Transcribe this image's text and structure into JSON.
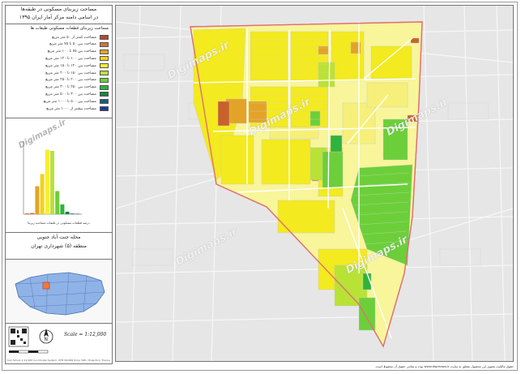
{
  "title": {
    "line1": "مساحت زیربنای مسکونی در طبقه‌ها",
    "line2": "در اسامی دامنه مرکز آمار ایران ۱۳۹۵"
  },
  "legend": {
    "title": "مساحت زیربنای قطعات مسکونی طبقات ها",
    "items": [
      {
        "label": "مساحت کمتر از ۵۰ متر مربع",
        "color": "#b5472c"
      },
      {
        "label": "مساحت بین ۵۰ تا ۷۵ متر مربع",
        "color": "#d2752e"
      },
      {
        "label": "مساحت بین ۷۵ تا ۱۰۰ متر مربع",
        "color": "#e3a329"
      },
      {
        "label": "مساحت بین ۱۰۰ تا ۱۲۰ متر مربع",
        "color": "#f2d21c"
      },
      {
        "label": "مساحت بین ۱۲۰ تا ۱۵۰ متر مربع",
        "color": "#f7ef2b"
      },
      {
        "label": "مساحت بین ۱۵۰ تا ۲۰۰ متر مربع",
        "color": "#b9e236"
      },
      {
        "label": "مساحت بین ۲۰۰ تا ۲۵۰ متر مربع",
        "color": "#6ccf3a"
      },
      {
        "label": "مساحت بین ۲۵۰ تا ۳۰۰ متر مربع",
        "color": "#2fb33c"
      },
      {
        "label": "مساحت بین ۳۰۰ تا ۵۰۰ متر مربع",
        "color": "#13863f"
      },
      {
        "label": "مساحت بین ۵۰۰ تا ۱۰۰۰ متر مربع",
        "color": "#115e7c"
      },
      {
        "label": "مساحت بیشتر از ۱۰۰۰ متر مربع",
        "color": "#1a3b8f"
      }
    ]
  },
  "chart_data": {
    "type": "bar",
    "categories": [
      "<50",
      "50-75",
      "75-100",
      "100-120",
      "120-150",
      "150-200",
      "200-250",
      "250-300",
      "300-500",
      "500-1000",
      ">1000"
    ],
    "values": [
      0.5,
      1,
      23,
      33,
      53,
      52,
      19,
      8,
      2,
      0.5,
      0.3
    ],
    "colors": [
      "#b5472c",
      "#d2752e",
      "#e3a329",
      "#f2d21c",
      "#f7ef2b",
      "#b9e236",
      "#6ccf3a",
      "#2fb33c",
      "#13863f",
      "#115e7c",
      "#1a3b8f"
    ],
    "ylim": [
      0,
      60
    ],
    "caption": "درصد قطعات مسکونی در طبقات مساحت زیربنا"
  },
  "subtitle": {
    "line1": "محله جنت آباد جنوبی",
    "line2": "منطقه (۵) شهرداری تهران"
  },
  "scale": "Scale = 1:12,000",
  "credits": "Iran Tehran 1:12,000 Coordinate System: UTM WGS84 Zone 39N / Projection: Transverse Mercator",
  "watermark": "Digimaps.ir",
  "footer": "حقوق مالکیت معنوی این محصول متعلق به سایت www.digimaps.ir بوده و تمامی حقوق آن محفوظ است."
}
